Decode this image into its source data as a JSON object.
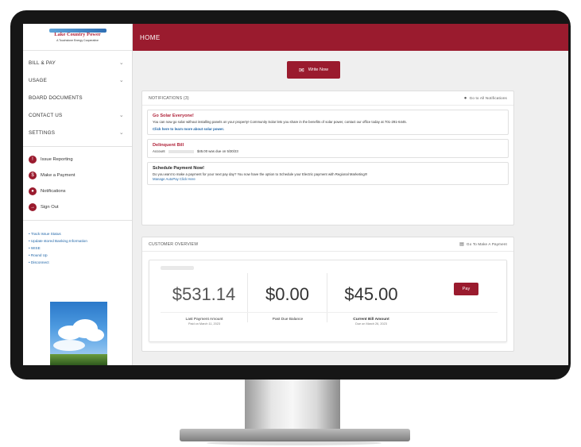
{
  "app": {
    "logo_text": "Lake Country Power",
    "logo_sub": "A Touchstone Energy Cooperative"
  },
  "sidebar": {
    "menu": [
      {
        "label": "BILL & PAY",
        "chevron": true
      },
      {
        "label": "USAGE",
        "chevron": true
      },
      {
        "label": "BOARD DOCUMENTS",
        "chevron": false
      },
      {
        "label": "CONTACT US",
        "chevron": true
      },
      {
        "label": "SETTINGS",
        "chevron": true
      }
    ],
    "quick": [
      {
        "label": "Issue Reporting",
        "icon": "alert-icon"
      },
      {
        "label": "Make a Payment",
        "icon": "dollar-icon"
      },
      {
        "label": "Notifications",
        "icon": "bell-icon"
      },
      {
        "label": "Sign Out",
        "icon": "signout-icon"
      }
    ],
    "links": [
      "Track Issue Status",
      "Update stored Banking Information",
      "WISE",
      "Round Up",
      "Disconnect"
    ]
  },
  "header": {
    "title": "HOME"
  },
  "write_button": {
    "label": "Write Now"
  },
  "notifications": {
    "title": "NOTIFICATIONS (3)",
    "action": "Go to All Notifications",
    "items": [
      {
        "title": "Go Solar Everyone!",
        "body": "You can now go solar without installing panels on your property! Community Solar lets you share in the benefits of solar power, contact our office today at 701-291-6445.",
        "link": "Click here to learn more about solar power."
      },
      {
        "title": "Delinquent Bill",
        "body_prefix": "Account",
        "body": "$45.00 was due on 5/30/23"
      },
      {
        "title": "Schedule Payment Now!",
        "body": "Do you want to make a payment for your next pay day? You now have the option to Schedule your Electric payment with Regional Marketing!!!",
        "link": "Manage AutoPay Click Here"
      }
    ]
  },
  "overview": {
    "title": "CUSTOMER OVERVIEW",
    "action": "Go To Make A Payment",
    "columns": [
      {
        "amount": "$531.14",
        "label": "Last Payment Amount",
        "sub": "Paid on March 11, 2023"
      },
      {
        "amount": "$0.00",
        "label": "Past Due Balance",
        "sub": ""
      },
      {
        "amount": "$45.00",
        "label": "Current Bill Amount",
        "sub": "Due on March 26, 2023"
      }
    ],
    "pay_label": "Pay"
  },
  "colors": {
    "brand": "#9a1b2e",
    "link": "#2166a8"
  }
}
